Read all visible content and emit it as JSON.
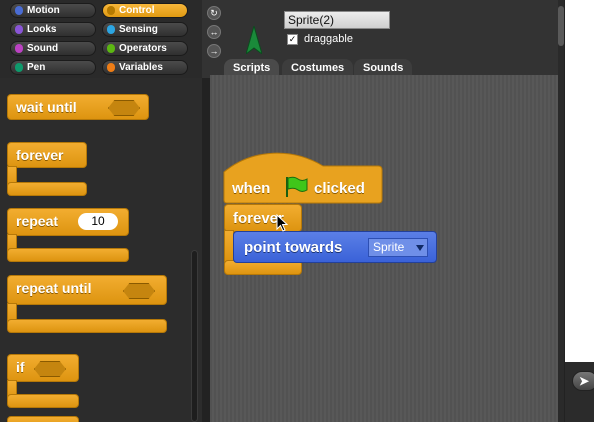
{
  "categories": [
    {
      "label": "Motion",
      "color": "#4a6cd4"
    },
    {
      "label": "Looks",
      "color": "#8a55d7"
    },
    {
      "label": "Sound",
      "color": "#bb42c3"
    },
    {
      "label": "Pen",
      "color": "#0e9a6c"
    },
    {
      "label": "Control",
      "color": "#e1a91a",
      "selected": true
    },
    {
      "label": "Sensing",
      "color": "#2ca5e2"
    },
    {
      "label": "Operators",
      "color": "#5cb712"
    },
    {
      "label": "Variables",
      "color": "#ee7d16"
    }
  ],
  "palette": {
    "wait_until": "wait until",
    "forever": "forever",
    "repeat": "repeat",
    "repeat_count": "10",
    "repeat_until": "repeat until",
    "if": "if"
  },
  "sprite": {
    "name": "Sprite(2)",
    "draggable_label": "draggable",
    "draggable_checked": "✓"
  },
  "rotation_buttons": [
    "↻",
    "↔",
    "→"
  ],
  "tabs": [
    {
      "label": "Scripts",
      "active": true
    },
    {
      "label": "Costumes"
    },
    {
      "label": "Sounds"
    }
  ],
  "script": {
    "hat_when": "when",
    "hat_clicked": "clicked",
    "forever": "forever",
    "point_towards": "point towards",
    "target": "Sprite"
  },
  "stage_button": "➤"
}
